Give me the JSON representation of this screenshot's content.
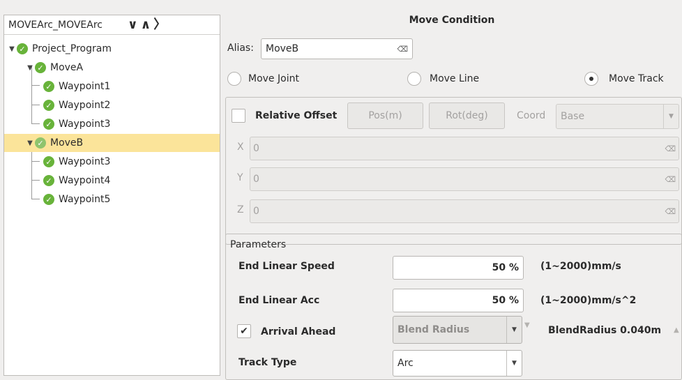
{
  "tree": {
    "header_title": "MOVEArc_MOVEArc",
    "nav_down": "∨",
    "nav_up": "∧",
    "nav_next": "〉",
    "items": [
      {
        "label": "Project_Program",
        "level": 0,
        "expanded": true
      },
      {
        "label": "MoveA",
        "level": 1,
        "expanded": true
      },
      {
        "label": "Waypoint1",
        "level": 2
      },
      {
        "label": "Waypoint2",
        "level": 2
      },
      {
        "label": "Waypoint3",
        "level": 2
      },
      {
        "label": "MoveB",
        "level": 1,
        "expanded": true,
        "selected": true
      },
      {
        "label": "Waypoint3",
        "level": 2
      },
      {
        "label": "Waypoint4",
        "level": 2
      },
      {
        "label": "Waypoint5",
        "level": 2
      }
    ]
  },
  "move_condition": {
    "title": "Move Condition",
    "alias_label": "Alias:",
    "alias_value": "MoveB",
    "move_types": [
      {
        "label": "Move Joint",
        "selected": false
      },
      {
        "label": "Move Line",
        "selected": false
      },
      {
        "label": "Move Track",
        "selected": true
      }
    ]
  },
  "offset": {
    "relative_offset_label": "Relative Offset",
    "relative_offset_checked": false,
    "pos_button": "Pos(m)",
    "rot_button": "Rot(deg)",
    "coord_label": "Coord",
    "coord_value": "Base",
    "x_label": "X",
    "x_value": "0",
    "y_label": "Y",
    "y_value": "0",
    "z_label": "Z",
    "z_value": "0"
  },
  "parameters": {
    "title": "Parameters",
    "end_linear_speed_label": "End Linear Speed",
    "end_linear_speed_value": "50 %",
    "end_linear_speed_range": "(1~2000)mm/s",
    "end_linear_acc_label": "End Linear Acc",
    "end_linear_acc_value": "50 %",
    "end_linear_acc_range": "(1~2000)mm/s^2",
    "arrival_ahead_label": "Arrival Ahead",
    "arrival_ahead_checked": true,
    "arrival_mode_value": "Blend Radius",
    "blend_radius_text": "BlendRadius 0.040m",
    "track_type_label": "Track Type",
    "track_type_value": "Arc"
  },
  "colors": {
    "selected_row": "#fbe49a",
    "check_green": "#68b33a"
  }
}
